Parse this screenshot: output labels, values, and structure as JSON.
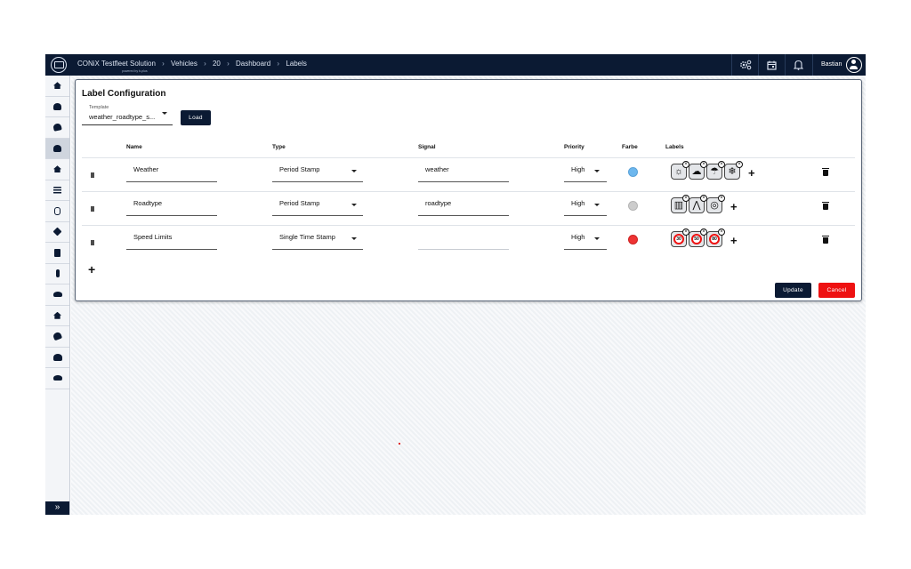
{
  "topbar": {
    "app_name": "CONiX Testfleet Solution",
    "powered_by": "powered by b-plus",
    "breadcrumbs": [
      "Vehicles",
      "20",
      "Dashboard",
      "Labels"
    ],
    "user_name": "Bastian",
    "icons": [
      "settings-cogs-icon",
      "calendar-icon",
      "bell-icon",
      "user-avatar-icon"
    ]
  },
  "sidebar": {
    "items": [
      {
        "icon": "home-icon",
        "active": false
      },
      {
        "icon": "car-front-icon",
        "active": false
      },
      {
        "icon": "car-tilt-icon",
        "active": false
      },
      {
        "icon": "car-icon",
        "active": true
      },
      {
        "icon": "landscape-icon",
        "active": false
      },
      {
        "icon": "list-icon",
        "active": false
      },
      {
        "icon": "capsule-icon",
        "active": false
      },
      {
        "icon": "cube-icon",
        "active": false
      },
      {
        "icon": "clipboard-icon",
        "active": false
      },
      {
        "icon": "thermometer-icon",
        "active": false
      },
      {
        "icon": "vehicle-side-icon",
        "active": false
      },
      {
        "icon": "garage-icon",
        "active": false
      },
      {
        "icon": "hand-icon",
        "active": false
      },
      {
        "icon": "users-icon",
        "active": false
      },
      {
        "icon": "chat-icon",
        "active": false
      }
    ],
    "expand_icon": "double-chevron-right-icon",
    "expand_glyph": "»"
  },
  "card": {
    "title": "Label Configuration",
    "template_label": "Template",
    "template_value": "weather_roadtype_s...",
    "load_button": "Load",
    "columns": {
      "name": "Name",
      "type": "Type",
      "signal": "Signal",
      "priority": "Priority",
      "farbe": "Farbe",
      "labels": "Labels"
    },
    "rows": [
      {
        "name": "Weather",
        "type": "Period Stamp",
        "signal": "weather",
        "priority": "High",
        "color": "#6db7ee",
        "labels": [
          {
            "icon": "sun-icon",
            "glyph": "☼"
          },
          {
            "icon": "cloud-icon",
            "glyph": "☁"
          },
          {
            "icon": "rain-icon",
            "glyph": "☂"
          },
          {
            "icon": "snowflake-icon",
            "glyph": "❄"
          }
        ]
      },
      {
        "name": "Roadtype",
        "type": "Period Stamp",
        "signal": "roadtype",
        "priority": "High",
        "color": "#cccccc",
        "labels": [
          {
            "icon": "city-icon",
            "glyph": "▥"
          },
          {
            "icon": "highway-icon",
            "glyph": "⋀"
          },
          {
            "icon": "country-road-icon",
            "glyph": "◎"
          }
        ]
      },
      {
        "name": "Speed Limits",
        "type": "Single Time Stamp",
        "signal": "",
        "priority": "High",
        "color": "#ee3333",
        "labels": [
          {
            "icon": "speed-limit-sign-icon",
            "glyph": "30"
          },
          {
            "icon": "speed-limit-sign-icon",
            "glyph": "50"
          },
          {
            "icon": "speed-limit-sign-icon",
            "glyph": "80"
          }
        ]
      }
    ],
    "add_row_glyph": "+",
    "update_button": "Update",
    "cancel_button": "Cancel"
  }
}
